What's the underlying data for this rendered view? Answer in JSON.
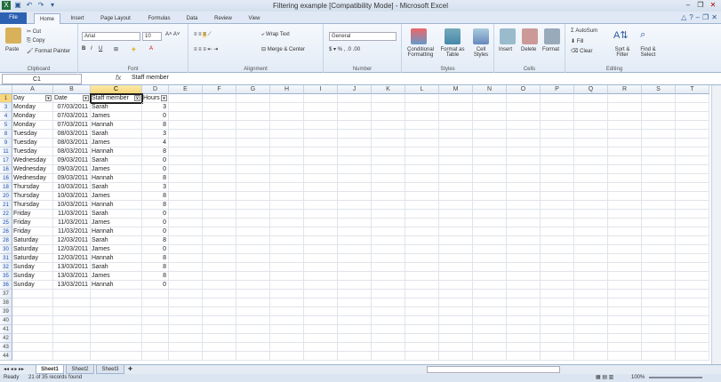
{
  "window": {
    "title": "Filtering example  [Compatibility Mode]  -  Microsoft Excel"
  },
  "tabs": [
    "File",
    "Home",
    "Insert",
    "Page Layout",
    "Formulas",
    "Data",
    "Review",
    "View"
  ],
  "ribbon": {
    "clipboard": {
      "paste": "Paste",
      "cut": "Cut",
      "copy": "Copy",
      "format_painter": "Format Painter",
      "label": "Clipboard"
    },
    "font": {
      "name": "Arial",
      "size": "10",
      "label": "Font"
    },
    "alignment": {
      "wrap": "Wrap Text",
      "merge": "Merge & Center",
      "label": "Alignment"
    },
    "number": {
      "format": "General",
      "label": "Number"
    },
    "styles": {
      "conditional": "Conditional Formatting",
      "format_table": "Format as Table",
      "cell_styles": "Cell Styles",
      "label": "Styles"
    },
    "cells": {
      "insert": "Insert",
      "delete": "Delete",
      "format": "Format",
      "label": "Cells"
    },
    "editing": {
      "autosum": "AutoSum",
      "fill": "Fill",
      "clear": "Clear",
      "sort": "Sort & Filter",
      "find": "Find & Select",
      "label": "Editing"
    }
  },
  "formula_bar": {
    "name_box": "C1",
    "fx": "fx",
    "value": "Staff member"
  },
  "columns": [
    "A",
    "B",
    "C",
    "D",
    "E",
    "F",
    "G",
    "H",
    "I",
    "J",
    "K",
    "L",
    "M",
    "N",
    "O",
    "P",
    "Q",
    "R",
    "S",
    "T"
  ],
  "header_row": {
    "row": "1",
    "day": "Day",
    "date": "Date",
    "staff": "Staff member",
    "hours": "Hours"
  },
  "rows": [
    {
      "row": "3",
      "day": "Monday",
      "date": "07/03/2011",
      "staff": "Sarah",
      "hours": "3"
    },
    {
      "row": "4",
      "day": "Monday",
      "date": "07/03/2011",
      "staff": "James",
      "hours": "0"
    },
    {
      "row": "5",
      "day": "Monday",
      "date": "07/03/2011",
      "staff": "Hannah",
      "hours": "8"
    },
    {
      "row": "8",
      "day": "Tuesday",
      "date": "08/03/2011",
      "staff": "Sarah",
      "hours": "3"
    },
    {
      "row": "9",
      "day": "Tuesday",
      "date": "08/03/2011",
      "staff": "James",
      "hours": "4"
    },
    {
      "row": "11",
      "day": "Tuesday",
      "date": "08/03/2011",
      "staff": "Hannah",
      "hours": "8"
    },
    {
      "row": "17",
      "day": "Wednesday",
      "date": "09/03/2011",
      "staff": "Sarah",
      "hours": "0"
    },
    {
      "row": "16",
      "day": "Wednesday",
      "date": "09/03/2011",
      "staff": "James",
      "hours": "0"
    },
    {
      "row": "16",
      "day": "Wednesday",
      "date": "09/03/2011",
      "staff": "Hannah",
      "hours": "8"
    },
    {
      "row": "18",
      "day": "Thursday",
      "date": "10/03/2011",
      "staff": "Sarah",
      "hours": "3"
    },
    {
      "row": "20",
      "day": "Thursday",
      "date": "10/03/2011",
      "staff": "James",
      "hours": "8"
    },
    {
      "row": "21",
      "day": "Thursday",
      "date": "10/03/2011",
      "staff": "Hannah",
      "hours": "8"
    },
    {
      "row": "22",
      "day": "Friday",
      "date": "11/03/2011",
      "staff": "Sarah",
      "hours": "0"
    },
    {
      "row": "25",
      "day": "Friday",
      "date": "11/03/2011",
      "staff": "James",
      "hours": "0"
    },
    {
      "row": "26",
      "day": "Friday",
      "date": "11/03/2011",
      "staff": "Hannah",
      "hours": "0"
    },
    {
      "row": "28",
      "day": "Saturday",
      "date": "12/03/2011",
      "staff": "Sarah",
      "hours": "8"
    },
    {
      "row": "30",
      "day": "Saturday",
      "date": "12/03/2011",
      "staff": "James",
      "hours": "0"
    },
    {
      "row": "31",
      "day": "Saturday",
      "date": "12/03/2011",
      "staff": "Hannah",
      "hours": "8"
    },
    {
      "row": "32",
      "day": "Sunday",
      "date": "13/03/2011",
      "staff": "Sarah",
      "hours": "8"
    },
    {
      "row": "35",
      "day": "Sunday",
      "date": "13/03/2011",
      "staff": "James",
      "hours": "8"
    },
    {
      "row": "36",
      "day": "Sunday",
      "date": "13/03/2011",
      "staff": "Hannah",
      "hours": "0"
    }
  ],
  "empty_rows": [
    "37",
    "38",
    "39",
    "40",
    "41",
    "42",
    "43",
    "44"
  ],
  "sheets": [
    "Sheet1",
    "Sheet2",
    "Sheet3"
  ],
  "status": {
    "ready": "Ready",
    "records": "21 of 35 records found",
    "zoom": "100%"
  }
}
